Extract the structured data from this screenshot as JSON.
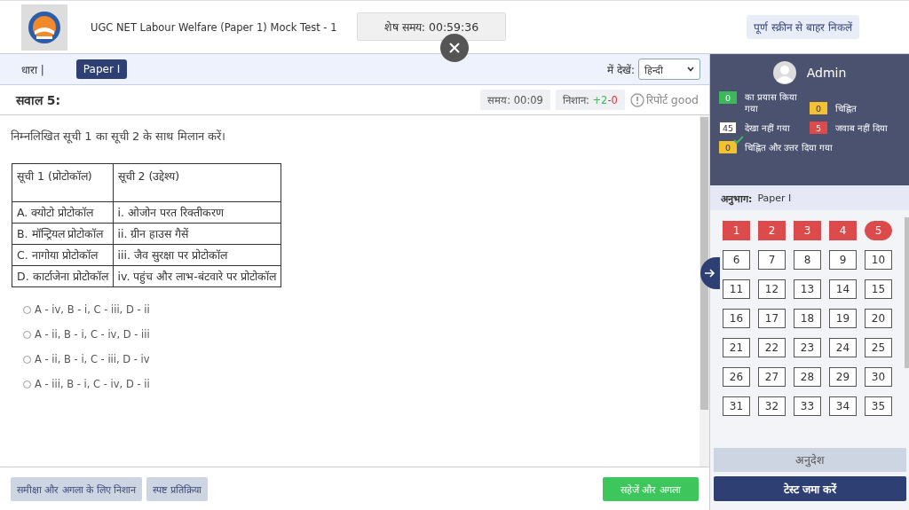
{
  "header": {
    "title": "UGC NET Labour Welfare (Paper 1) Mock Test - 1",
    "timer": "शेष समय: 00:59:36",
    "exit_fullscreen": "पूर्ण स्क्रीन से बाहर निकलें"
  },
  "section_bar": {
    "label": "धारा |",
    "sections": [
      {
        "label": "Paper I",
        "selected": true
      }
    ],
    "view_label": "में देखें:",
    "language": "हिन्दी"
  },
  "question": {
    "number": "सवाल 5:",
    "time": "समय: 00:09",
    "marks_label": "निशान:",
    "positive": "+2",
    "negative": "-0",
    "report": "रिपोर्ट good",
    "text": "निम्नलिखित सूची 1 का सूची 2 के साथ मिलान करें।",
    "table": {
      "columns": [
        "सूची 1 (प्रोटोकॉल)",
        "सूची 2 (उद्देश्य)"
      ],
      "rows": [
        [
          "A. क्योटो प्रोटोकॉल",
          "i. ओजोन परत रिक्तीकरण"
        ],
        [
          "B. मॉन्ट्रियल प्रोटोकॉल",
          "ii. ग्रीन हाउस गैसें"
        ],
        [
          "C. नागोया प्रोटोकॉल",
          "iii. जैव सुरक्षा पर प्रोटोकॉल"
        ],
        [
          "D. कार्टाजेना प्रोटोकॉल",
          "iv. पहुंच और लाभ-बंटवारे पर प्रोटोकॉल"
        ]
      ]
    },
    "options": [
      {
        "label": "A - iv, B - i, C - iii, D - ii",
        "selected": false
      },
      {
        "label": "A - ii, B - i, C - iv, D - iii",
        "selected": false
      },
      {
        "label": "A - ii, B - i, C - iii, D - iv",
        "selected": false
      },
      {
        "label": "A - iii, B - i, C - iv, D - ii",
        "selected": false
      }
    ]
  },
  "footer": {
    "mark_review": "समीक्षा और अगला के लिए निशान",
    "clear": "स्पष्ट प्रतिक्रिया",
    "save_next": "सहेजें और अगला"
  },
  "panel": {
    "user": "Admin",
    "legend": [
      {
        "count": "0",
        "label": "का प्रयास किया गया",
        "kind": "answered"
      },
      {
        "count": "0",
        "label": "चिह्नित",
        "kind": "marked"
      },
      {
        "count": "45",
        "label": "देखा नहीं गया",
        "kind": "not_visited"
      },
      {
        "count": "5",
        "label": "जवाब नहीं दिया",
        "kind": "not_answered"
      },
      {
        "count": "0",
        "label": "चिह्नित और उत्तर दिया गया",
        "kind": "marked_answered"
      }
    ],
    "section_label": "अनुभाग:",
    "section_name": "Paper I",
    "questions": [
      {
        "label": "1",
        "kind": "not_answered",
        "selected": false
      },
      {
        "label": "2",
        "kind": "not_answered",
        "selected": false
      },
      {
        "label": "3",
        "kind": "not_answered",
        "selected": false
      },
      {
        "label": "4",
        "kind": "not_answered",
        "selected": false
      },
      {
        "label": "5",
        "kind": "not_answered",
        "selected": true
      },
      {
        "label": "6",
        "kind": "not_visited",
        "selected": false
      },
      {
        "label": "7",
        "kind": "not_visited",
        "selected": false
      },
      {
        "label": "8",
        "kind": "not_visited",
        "selected": false
      },
      {
        "label": "9",
        "kind": "not_visited",
        "selected": false
      },
      {
        "label": "10",
        "kind": "not_visited",
        "selected": false
      },
      {
        "label": "11",
        "kind": "not_visited",
        "selected": false
      },
      {
        "label": "12",
        "kind": "not_visited",
        "selected": false
      },
      {
        "label": "13",
        "kind": "not_visited",
        "selected": false
      },
      {
        "label": "14",
        "kind": "not_visited",
        "selected": false
      },
      {
        "label": "15",
        "kind": "not_visited",
        "selected": false
      },
      {
        "label": "16",
        "kind": "not_visited",
        "selected": false
      },
      {
        "label": "17",
        "kind": "not_visited",
        "selected": false
      },
      {
        "label": "18",
        "kind": "not_visited",
        "selected": false
      },
      {
        "label": "19",
        "kind": "not_visited",
        "selected": false
      },
      {
        "label": "20",
        "kind": "not_visited",
        "selected": false
      },
      {
        "label": "21",
        "kind": "not_visited",
        "selected": false
      },
      {
        "label": "22",
        "kind": "not_visited",
        "selected": false
      },
      {
        "label": "23",
        "kind": "not_visited",
        "selected": false
      },
      {
        "label": "24",
        "kind": "not_visited",
        "selected": false
      },
      {
        "label": "25",
        "kind": "not_visited",
        "selected": false
      },
      {
        "label": "26",
        "kind": "not_visited",
        "selected": false
      },
      {
        "label": "27",
        "kind": "not_visited",
        "selected": false
      },
      {
        "label": "28",
        "kind": "not_visited",
        "selected": false
      },
      {
        "label": "29",
        "kind": "not_visited",
        "selected": false
      },
      {
        "label": "30",
        "kind": "not_visited",
        "selected": false
      },
      {
        "label": "31",
        "kind": "not_visited",
        "selected": false
      },
      {
        "label": "32",
        "kind": "not_visited",
        "selected": false
      },
      {
        "label": "33",
        "kind": "not_visited",
        "selected": false
      },
      {
        "label": "34",
        "kind": "not_visited",
        "selected": false
      },
      {
        "label": "35",
        "kind": "not_visited",
        "selected": false
      }
    ],
    "instructions": "अनुदेश",
    "submit": "टेस्ट जमा करें"
  }
}
